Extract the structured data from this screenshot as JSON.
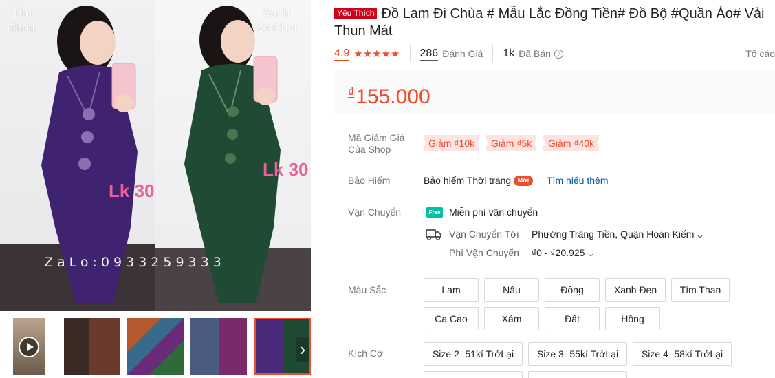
{
  "gallery": {
    "label_left": "Tím\nThan",
    "label_right": "Xanh\nVe Chai",
    "overlay_left": "Lk 30",
    "overlay_right": "Lk 30",
    "watermark": "ZaLo:0933259333",
    "next_arrow": "›"
  },
  "product": {
    "badge": "Yêu Thích",
    "title": "Đồ Lam Đi Chùa # Mẫu Lắc Đồng Tiền# Đồ Bộ #Quần Áo# Vải Thun Mát",
    "rating": "4.9",
    "stars": "★★★★★",
    "reviews_count": "286",
    "reviews_label": "Đánh Giá",
    "sold_count": "1k",
    "sold_label": "Đã Bán",
    "report_label": "Tố cáo",
    "currency": "₫",
    "price": "155.000"
  },
  "voucher": {
    "label": "Mã Giảm Giá\nCủa Shop",
    "items": [
      "Giảm ₫10k",
      "Giảm ₫5k",
      "Giảm ₫40k"
    ]
  },
  "insurance": {
    "label": "Bảo Hiểm",
    "name": "Bảo hiểm Thời trang",
    "badge": "Mới",
    "link": "Tìm hiểu thêm"
  },
  "shipping": {
    "label": "Vận Chuyển",
    "free_icon": "Free",
    "free_text": "Miễn phí vận chuyển",
    "to_label": "Vận Chuyển Tới",
    "to_value": "Phường Tràng Tiền, Quận Hoàn Kiếm",
    "fee_label": "Phí Vận Chuyển",
    "fee_value": "₫0 - ₫20.925"
  },
  "colors": {
    "label": "Màu Sắc",
    "options": [
      "Lam",
      "Nâu",
      "Đồng",
      "Xanh Đen",
      "Tím Than",
      "Ca Cao",
      "Xám",
      "Đất",
      "Hồng"
    ]
  },
  "sizes": {
    "label": "Kích Cỡ",
    "options": [
      "Size 2- 51kí TrởLại",
      "Size 3- 55kí TrởLại",
      "Size 4- 58kí TrởLại"
    ]
  },
  "theme": {
    "accent": "#ee4d2d",
    "link": "#0055aa",
    "free_ship": "#00bfa5",
    "purple_outfit": "#4a2a7a",
    "green_outfit": "#1f4a33"
  }
}
